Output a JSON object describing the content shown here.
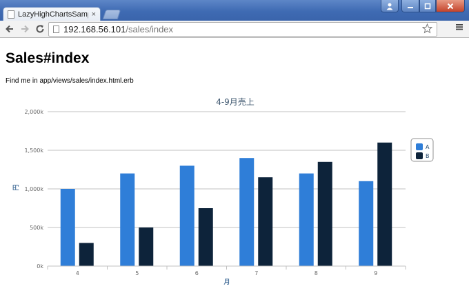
{
  "browser": {
    "tab_title": "LazyHighChartsSample",
    "tab_close": "×",
    "url_host": "192.168.56.101",
    "url_path": "/sales/index"
  },
  "page": {
    "title": "Sales#index",
    "note": "Find me in app/views/sales/index.html.erb"
  },
  "colors": {
    "series_a": "#2f7ed8",
    "series_b": "#0d233a",
    "title": "#3e576f",
    "grid": "#c0c0c0",
    "axis_label": "#4d759e",
    "tick_label": "#666666"
  },
  "chart_data": {
    "type": "bar",
    "title": "4-9月売上",
    "xlabel": "月",
    "ylabel": "円",
    "categories": [
      "4",
      "5",
      "6",
      "7",
      "8",
      "9"
    ],
    "ylim": [
      0,
      2000
    ],
    "yticks": [
      0,
      500,
      1000,
      1500,
      2000
    ],
    "ytick_labels": [
      "0k",
      "500k",
      "1,000k",
      "1,500k",
      "2,000k"
    ],
    "grid": true,
    "legend": "right",
    "series": [
      {
        "name": "A",
        "values": [
          1000,
          1200,
          1300,
          1400,
          1200,
          1100
        ]
      },
      {
        "name": "B",
        "values": [
          300,
          500,
          750,
          1150,
          1350,
          1600
        ]
      }
    ]
  }
}
